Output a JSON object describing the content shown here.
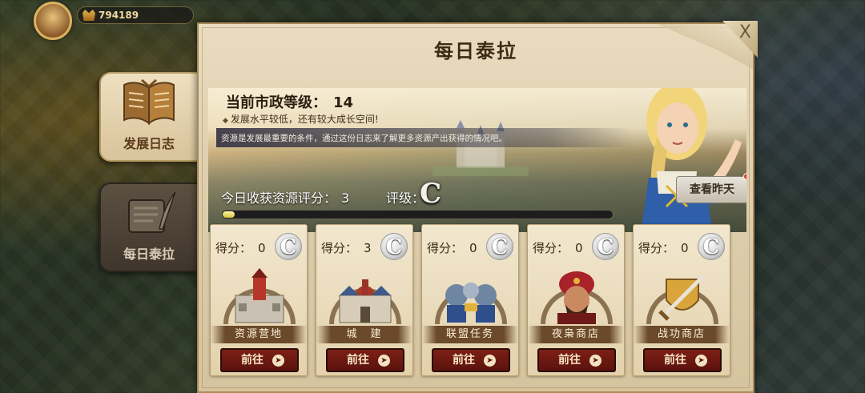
{
  "hud": {
    "power": "794189"
  },
  "side_tabs": [
    {
      "label": "发展日志",
      "active": true
    },
    {
      "label": "每日泰拉",
      "active": false
    }
  ],
  "panel": {
    "title": "每日泰拉",
    "close_icon": "X"
  },
  "banner": {
    "civic_level_label": "当前市政等级：",
    "civic_level_value": "14",
    "growth_note": "发展水平较低，还有较大成长空间!",
    "intro": "资源是发展最重要的条件，通过这份日志来了解更多资源产出获得的情况吧。",
    "score_label": "今日收获资源评分：",
    "score_value": "3",
    "rating_label": "评级：",
    "rating_value": "C",
    "progress": 0.03,
    "view_yesterday": "查看昨天"
  },
  "cards": [
    {
      "score_label": "得分：",
      "score": "0",
      "grade": "C",
      "name": "资源营地",
      "go": "前往",
      "icon": "castle-camp-icon"
    },
    {
      "score_label": "得分：",
      "score": "3",
      "grade": "C",
      "name": "城　建",
      "go": "前往",
      "icon": "city-building-icon"
    },
    {
      "score_label": "得分：",
      "score": "0",
      "grade": "C",
      "name": "联盟任务",
      "go": "前往",
      "icon": "alliance-warriors-icon"
    },
    {
      "score_label": "得分：",
      "score": "0",
      "grade": "C",
      "name": "夜枭商店",
      "go": "前往",
      "icon": "night-owl-merchant-icon"
    },
    {
      "score_label": "得分：",
      "score": "0",
      "grade": "C",
      "name": "战功商店",
      "go": "前往",
      "icon": "sword-shield-icon"
    }
  ]
}
